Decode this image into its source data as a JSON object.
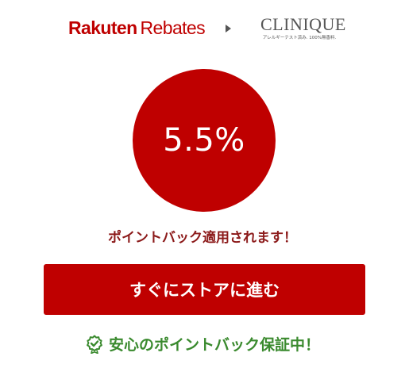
{
  "header": {
    "rakuten_word": "Rakuten",
    "rebates_word": "Rebates",
    "store_logo_name": "CLINIQUE",
    "store_logo_tagline": "アレルギーテスト済み. 100%無香料."
  },
  "rate": {
    "value": "5.5%"
  },
  "applied_message": "ポイントバック適用されます！",
  "cta": {
    "label": "すぐにストアに進む"
  },
  "guarantee": {
    "label": "安心のポイントバック保証中！"
  },
  "colors": {
    "brand_red": "#bf0000",
    "message_red": "#8c1a1a",
    "guarantee_green": "#3a8a2e"
  },
  "icons": {
    "arrow": "chevron-right-icon",
    "guarantee": "shield-check-icon"
  }
}
